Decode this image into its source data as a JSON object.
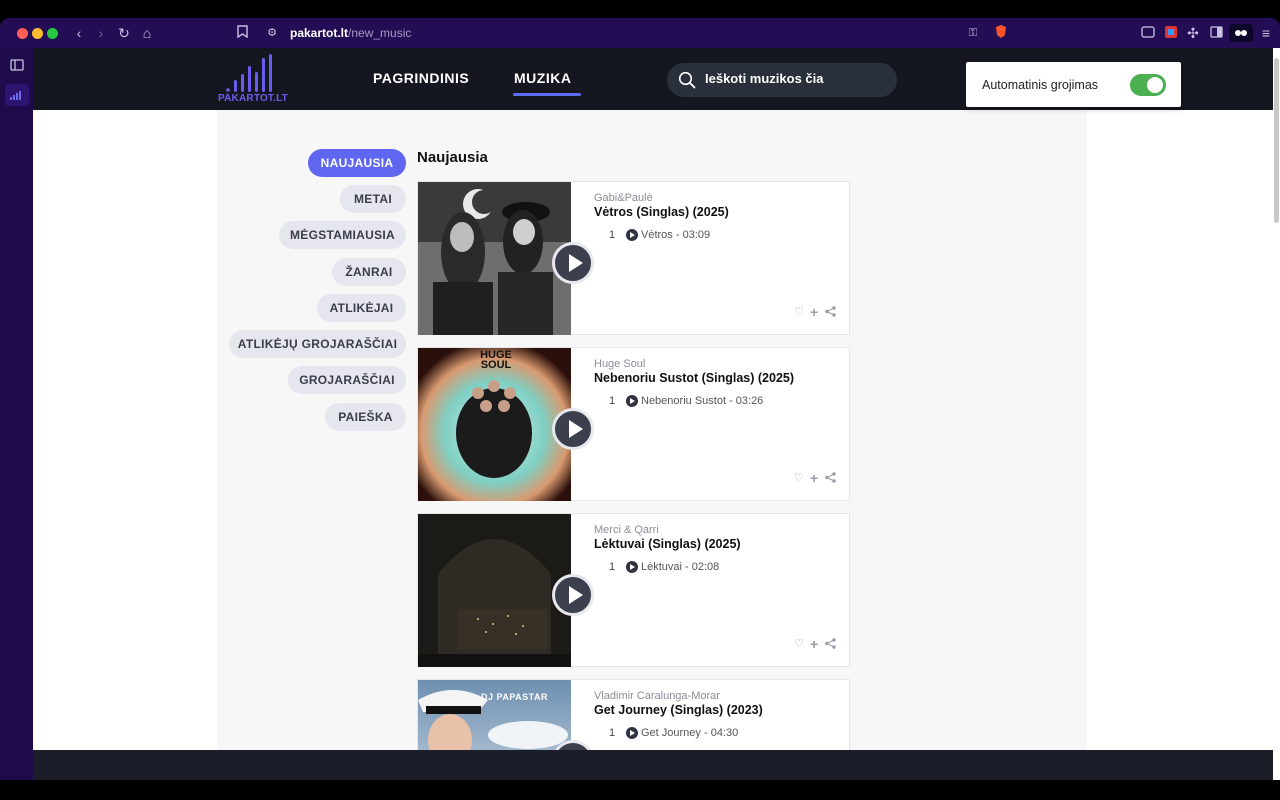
{
  "browser": {
    "url_host": "pakartot.lt",
    "url_path": "/new_music"
  },
  "site": {
    "logo_text": "PAKARTOT.LT",
    "nav": [
      {
        "label": "PAGRINDINIS"
      },
      {
        "label": "MUZIKA"
      }
    ],
    "search_placeholder": "Ieškoti muzikos čia"
  },
  "popup": {
    "label": "Automatinis grojimas",
    "toggle_on": true
  },
  "sidebar": {
    "items": [
      {
        "label": "NAUJAUSIA",
        "active": true
      },
      {
        "label": "METAI"
      },
      {
        "label": "MĖGSTAMIAUSIA"
      },
      {
        "label": "ŽANRAI"
      },
      {
        "label": "ATLIKĖJAI"
      },
      {
        "label": "ATLIKĖJŲ GROJARAŠČIAI"
      },
      {
        "label": "GROJARAŠČIAI"
      },
      {
        "label": "PAIEŠKA"
      }
    ]
  },
  "main": {
    "title": "Naujausia",
    "albums": [
      {
        "artist": "Gabi&Paulė",
        "title": "Vėtros (Singlas) (2025)",
        "track_no": "1",
        "track": "Vėtros - 03:09",
        "cover_text": ""
      },
      {
        "artist": "Huge Soul",
        "title": "Nebenoriu Sustot (Singlas) (2025)",
        "track_no": "1",
        "track": "Nebenoriu Sustot - 03:26",
        "cover_text": "HUGE SOUL"
      },
      {
        "artist": "Merci & Qarri",
        "title": "Lėktuvai (Singlas) (2025)",
        "track_no": "1",
        "track": "Lėktuvai - 02:08",
        "cover_text": ""
      },
      {
        "artist": "Vladimir Caralunga-Morar",
        "title": "Get Journey (Singlas) (2023)",
        "track_no": "1",
        "track": "Get Journey - 04:30",
        "cover_text": "DJ PAPASTAR"
      }
    ]
  },
  "colors": {
    "accent": "#5f66f0",
    "header_bg": "#141720",
    "browser_chrome": "#230d55",
    "toggle_on": "#4caf50"
  }
}
